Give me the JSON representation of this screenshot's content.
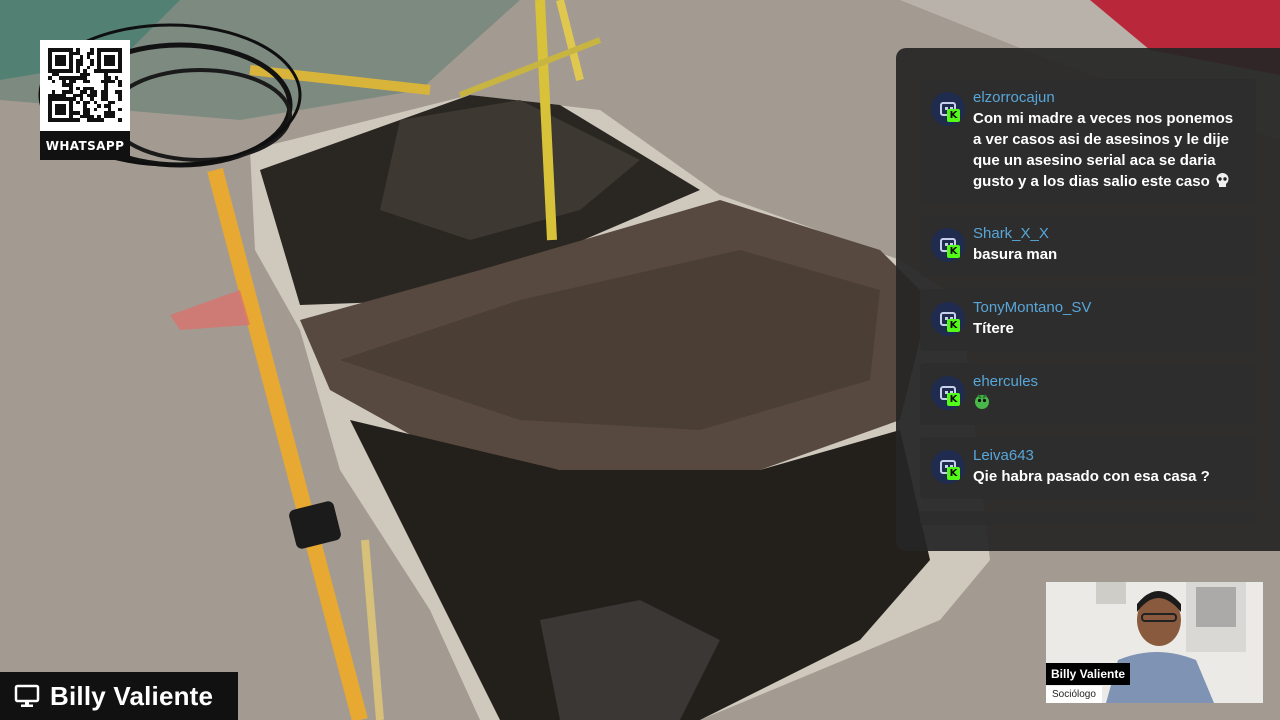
{
  "qr_widget": {
    "label": "WHATSAPP"
  },
  "chat": {
    "messages": [
      {
        "username": "elzorrocajun",
        "text": "Con mi madre a veces nos ponemos a ver casos asi de asesinos y le dije que un asesino serial aca se daria gusto y a los dias salio este caso",
        "emoji": "skull-emote"
      },
      {
        "username": "Shark_X_X",
        "text": "basura man"
      },
      {
        "username": "TonyMontano_SV",
        "text": "Títere"
      },
      {
        "username": "ehercules",
        "text": "",
        "emoji": "green-emote"
      },
      {
        "username": "Leiva643",
        "text": "Qie habra pasado con esa casa ?"
      }
    ],
    "badge_color": "#53fc18",
    "username_color": "#58a6d9"
  },
  "camera": {
    "name": "Billy Valiente",
    "role": "Sociólogo"
  },
  "streamer": {
    "name": "Billy Valiente",
    "icon": "monitor-icon"
  }
}
